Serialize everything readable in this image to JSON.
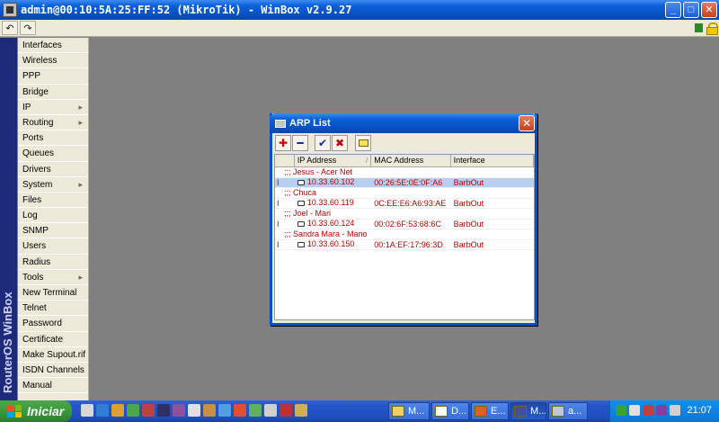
{
  "window": {
    "title": "admin@00:10:5A:25:FF:52 (MikroTik) - WinBox v2.9.27",
    "minimize": "_",
    "maximize": "□",
    "close": "✕"
  },
  "toolbar": {
    "undo": "↶",
    "redo": "↷"
  },
  "brand": "RouterOS WinBox",
  "menu": {
    "items": [
      {
        "label": "Interfaces",
        "arrow": ""
      },
      {
        "label": "Wireless",
        "arrow": ""
      },
      {
        "label": "PPP",
        "arrow": ""
      },
      {
        "label": "Bridge",
        "arrow": ""
      },
      {
        "label": "IP",
        "arrow": "▸"
      },
      {
        "label": "Routing",
        "arrow": "▸"
      },
      {
        "label": "Ports",
        "arrow": ""
      },
      {
        "label": "Queues",
        "arrow": ""
      },
      {
        "label": "Drivers",
        "arrow": ""
      },
      {
        "label": "System",
        "arrow": "▸"
      },
      {
        "label": "Files",
        "arrow": ""
      },
      {
        "label": "Log",
        "arrow": ""
      },
      {
        "label": "SNMP",
        "arrow": ""
      },
      {
        "label": "Users",
        "arrow": ""
      },
      {
        "label": "Radius",
        "arrow": ""
      },
      {
        "label": "Tools",
        "arrow": "▸"
      },
      {
        "label": "New Terminal",
        "arrow": ""
      },
      {
        "label": "Telnet",
        "arrow": ""
      },
      {
        "label": "Password",
        "arrow": ""
      },
      {
        "label": "Certificate",
        "arrow": ""
      },
      {
        "label": "Make Supout.rif",
        "arrow": ""
      },
      {
        "label": "ISDN Channels",
        "arrow": ""
      },
      {
        "label": "Manual",
        "arrow": ""
      }
    ]
  },
  "arp": {
    "title": "ARP List",
    "close": "✕",
    "tools": {
      "add": "✚",
      "remove": "━",
      "enable": "✔",
      "disable": "✖"
    },
    "columns": [
      "",
      "IP Address",
      "MAC Address",
      "Interface"
    ],
    "sort_indicator": "/",
    "rows": [
      {
        "kind": "comment",
        "text": ";;; Jesus - Acer Net"
      },
      {
        "kind": "entry",
        "flag": "I",
        "ip": "10.33.60.102",
        "mac": "00:26:5E:0E:0F:A6",
        "iface": "BarbOut",
        "selected": true
      },
      {
        "kind": "comment",
        "text": ";;; Chuca"
      },
      {
        "kind": "entry",
        "flag": "I",
        "ip": "10.33.60.119",
        "mac": "0C:EE:E6:A6:93:AE",
        "iface": "BarbOut"
      },
      {
        "kind": "comment",
        "text": ";;; Joel - Mari"
      },
      {
        "kind": "entry",
        "flag": "I",
        "ip": "10.33.60.124",
        "mac": "00:02:6F:53:68:6C",
        "iface": "BarbOut"
      },
      {
        "kind": "comment",
        "text": ";;; Sandra Mara - Mano"
      },
      {
        "kind": "entry",
        "flag": "I",
        "ip": "10.33.60.150",
        "mac": "00:1A:EF:17:96:3D",
        "iface": "BarbOut"
      }
    ]
  },
  "taskbar": {
    "start": "Iniciar",
    "tasks": [
      "M...",
      "D...",
      "E...",
      "M...",
      "a..."
    ],
    "clock": "21:07"
  },
  "colors": {
    "title_blue": "#0a5fd8",
    "arp_text": "#c00000",
    "selected_row": "#b9cff0",
    "desktop": "#808080",
    "menu_bg": "#ece9d8",
    "brand_strip": "#1e2a7a"
  }
}
